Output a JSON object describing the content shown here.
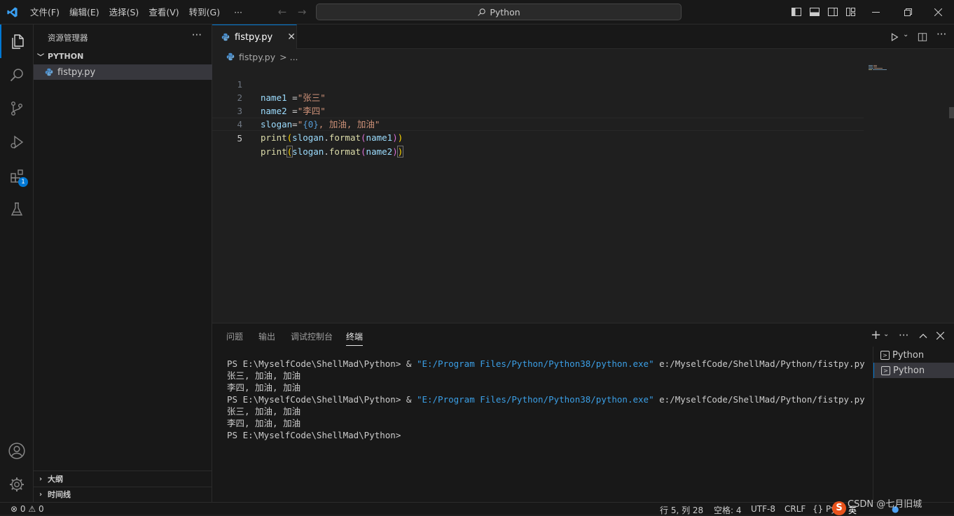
{
  "titlebar": {
    "menus": [
      "文件(F)",
      "编辑(E)",
      "选择(S)",
      "查看(V)",
      "转到(G)"
    ],
    "more": "···",
    "search_text": "Python"
  },
  "activity": {
    "extensions_badge": "1"
  },
  "sidebar": {
    "title": "资源管理器",
    "more": "···",
    "folder": "PYTHON",
    "file": "fistpy.py",
    "outline": "大纲",
    "timeline": "时间线"
  },
  "editor": {
    "tab_label": "fistpy.py",
    "tab_close": "✕",
    "breadcrumb_file": "fistpy.py",
    "breadcrumb_rest": "> ...",
    "line_numbers": [
      "1",
      "2",
      "3",
      "4",
      "5"
    ],
    "lines": [
      {
        "var": "name1",
        "op": " =",
        "str": "\"张三\""
      },
      {
        "var": "name2",
        "op": " =",
        "str": "\"李四\""
      },
      {
        "var": "slogan",
        "op": "=",
        "str_a": "\"",
        "brace": "{0}",
        "str_b": ", 加油, 加油\""
      },
      {
        "func": "print",
        "open": "(",
        "obj": "slogan",
        "dot": ".",
        "meth": "format",
        "open2": "(",
        "arg": "name1",
        "close2": ")",
        "close": ")"
      },
      {
        "func": "print",
        "open": "(",
        "obj": "slogan",
        "dot": ".",
        "meth": "format",
        "open2": "(",
        "arg": "name2",
        "close2": ")",
        "close": ")"
      }
    ]
  },
  "panel": {
    "tabs": [
      "问题",
      "输出",
      "调试控制台",
      "终端"
    ],
    "active_tab": "终端",
    "terminal_lines": [
      {
        "prompt": "PS E:\\MyselfCode\\ShellMad\\Python> & ",
        "exe": "\"E:/Program Files/Python/Python38/python.exe\"",
        "arg": " e:/MyselfCode/ShellMad/Python/fistpy.py"
      },
      {
        "text": "张三, 加油, 加油"
      },
      {
        "text": "李四, 加油, 加油"
      },
      {
        "prompt": "PS E:\\MyselfCode\\ShellMad\\Python> & ",
        "exe": "\"E:/Program Files/Python/Python38/python.exe\"",
        "arg": " e:/MyselfCode/ShellMad/Python/fistpy.py"
      },
      {
        "text": "张三, 加油, 加油"
      },
      {
        "text": "李四, 加油, 加油"
      },
      {
        "text": "PS E:\\MyselfCode\\ShellMad\\Python>"
      }
    ],
    "terminals": [
      "Python",
      "Python"
    ]
  },
  "status": {
    "errors": "0",
    "warnings": "0",
    "position": "行 5, 列 28",
    "indent": "空格: 4",
    "encoding": "UTF-8",
    "eol": "CRLF",
    "lang": "Py",
    "ime": "英",
    "watermark": "CSDN @七月旧城"
  }
}
